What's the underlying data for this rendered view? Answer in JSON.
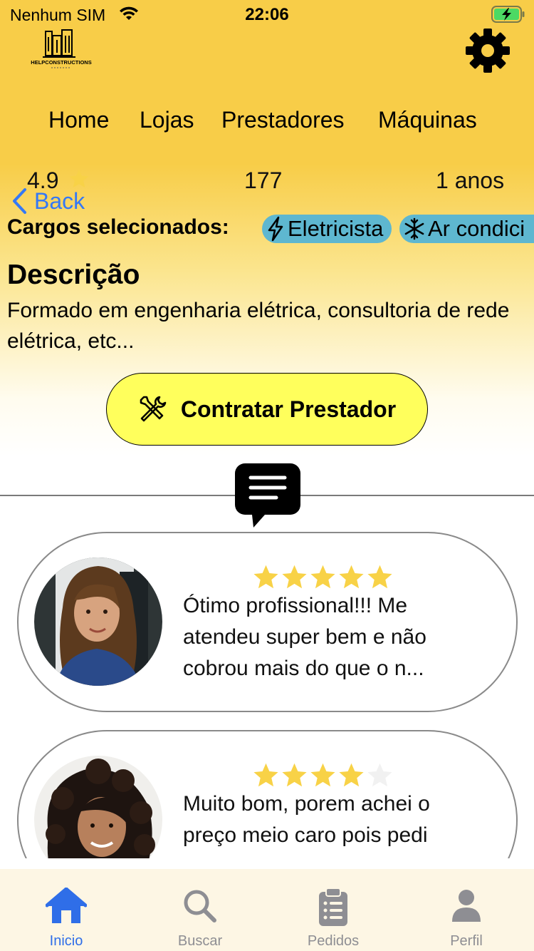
{
  "status_bar": {
    "carrier": "Nenhum SIM",
    "time": "22:06"
  },
  "header": {
    "logo_text": "HELPCONSTRUCTIONS",
    "settings_icon": "gear-icon"
  },
  "nav": {
    "items": [
      "Home",
      "Lojas",
      "Prestadores",
      "Máquinas"
    ]
  },
  "provider_stats": {
    "rating": "4.9",
    "count": "177",
    "years": "1 anos"
  },
  "back": {
    "label": "Back"
  },
  "cargos": {
    "label": "Cargos selecionados:",
    "chips": [
      {
        "label": "Eletricista",
        "icon": "lightning-icon"
      },
      {
        "label": "Ar condici",
        "icon": "snowflake-icon"
      }
    ]
  },
  "description": {
    "title": "Descrição",
    "text": "Formado em engenharia elétrica, consultoria de rede elétrica, etc..."
  },
  "hire_button": {
    "label": "Contratar Prestador"
  },
  "reviews": [
    {
      "rating": 5,
      "text": "Ótimo profissional!!! Me atendeu super bem e não cobrou mais do que o n..."
    },
    {
      "rating": 4,
      "text": "Muito bom, porem achei o preço meio caro pois pedi"
    }
  ],
  "tab_bar": {
    "tabs": [
      {
        "label": "Inicio",
        "icon": "home-icon",
        "active": true
      },
      {
        "label": "Buscar",
        "icon": "search-icon",
        "active": false
      },
      {
        "label": "Pedidos",
        "icon": "clipboard-icon",
        "active": false
      },
      {
        "label": "Perfil",
        "icon": "person-icon",
        "active": false
      }
    ]
  },
  "colors": {
    "header_yellow": "#f8cd48",
    "button_yellow": "#ffff5c",
    "chip_blue": "#5eb7d0",
    "star_gold": "#f8d247",
    "link_blue": "#3478f6",
    "tab_active": "#2f6ee8",
    "tab_inactive": "#8e8e93"
  }
}
